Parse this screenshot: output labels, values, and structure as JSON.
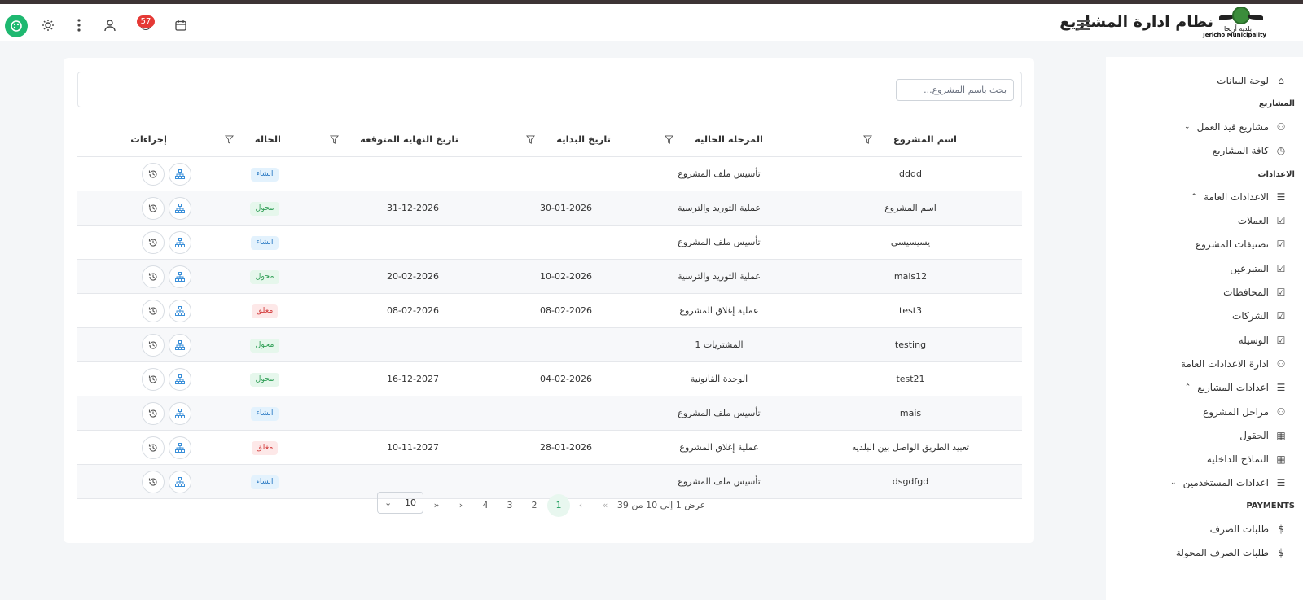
{
  "header": {
    "app_title": "نظام ادارة المشاريع",
    "logo_ar": "بلدية أريحا",
    "logo_en": "Jericho Municipality",
    "notification_count": "57"
  },
  "sidebar": {
    "dashboard": "لوحة البيانات",
    "section_projects": "المشاريع",
    "projects_in_progress": "مشاريع قيد العمل",
    "all_projects": "كافة المشاريع",
    "section_settings": "الاعدادات",
    "general_settings": "الاعدادات العامة",
    "currencies": "العملات",
    "project_categories": "تصنيفات المشروع",
    "donors": "المتبرعين",
    "governorates": "المحافظات",
    "companies": "الشركات",
    "method": "الوسيلة",
    "general_settings_admin": "ادارة الاعدادات العامة",
    "project_settings": "اعدادات المشاريع",
    "project_phases": "مراحل المشروع",
    "fields": "الحقول",
    "internal_forms": "النماذج الداخلية",
    "user_settings": "اعدادات المستخدمين",
    "section_payments": "PAYMENTS",
    "payment_requests": "طلبات الصرف",
    "transferred_payment_requests": "طلبات الصرف المحولة"
  },
  "search": {
    "placeholder": "بحث باسم المشروع..."
  },
  "table": {
    "headers": {
      "name": "اسم المشروع",
      "phase": "المرحلة الحالية",
      "start": "تاريخ البداية",
      "end": "تاريخ النهاية المتوقعة",
      "status": "الحالة",
      "actions": "إجراءات"
    },
    "rows": [
      {
        "name": "dddd",
        "phase": "تأسيس ملف المشروع",
        "start": "",
        "end": "",
        "status": "انشاء"
      },
      {
        "name": "اسم المشروع",
        "phase": "عملية التوريد والترسية",
        "start": "30-01-2026",
        "end": "31-12-2026",
        "status": "محول"
      },
      {
        "name": "يسيسيسي",
        "phase": "تأسيس ملف المشروع",
        "start": "",
        "end": "",
        "status": "انشاء"
      },
      {
        "name": "mais12",
        "phase": "عملية التوريد والترسية",
        "start": "10-02-2026",
        "end": "20-02-2026",
        "status": "محول"
      },
      {
        "name": "test3",
        "phase": "عملية إغلاق المشروع",
        "start": "08-02-2026",
        "end": "08-02-2026",
        "status": "مغلق"
      },
      {
        "name": "testing",
        "phase": "المشتريات 1",
        "start": "",
        "end": "",
        "status": "محول"
      },
      {
        "name": "test21",
        "phase": "الوحدة القانونية",
        "start": "04-02-2026",
        "end": "16-12-2027",
        "status": "محول"
      },
      {
        "name": "mais",
        "phase": "تأسيس ملف المشروع",
        "start": "",
        "end": "",
        "status": "انشاء"
      },
      {
        "name": "تعبيد الطريق الواصل بين البلديه",
        "phase": "عملية إغلاق المشروع",
        "start": "28-01-2026",
        "end": "10-11-2027",
        "status": "مغلق"
      },
      {
        "name": "dsgdfgd",
        "phase": "تأسيس ملف المشروع",
        "start": "",
        "end": "",
        "status": "انشاء"
      }
    ]
  },
  "pagination": {
    "summary": "عرض 1 إلى 10 من 39",
    "first": "«",
    "prev": "‹",
    "pages": [
      "1",
      "2",
      "3",
      "4"
    ],
    "next": "›",
    "last": "»",
    "page_size": "10"
  },
  "colors": {
    "accent": "#1eb870",
    "status_create": "#2e7cc4",
    "status_transferred": "#2f9e55",
    "status_closed": "#d33b3b"
  }
}
